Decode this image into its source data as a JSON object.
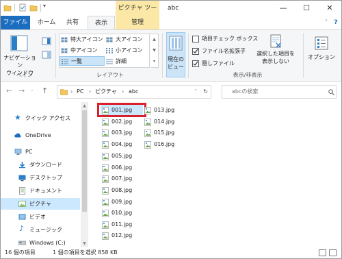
{
  "titlebar": {
    "context_tab": "ピクチャ ツール",
    "title": "abc",
    "minimize": "—",
    "maximize": "☐",
    "close": "✕"
  },
  "tabs": {
    "file": "ファイル",
    "home": "ホーム",
    "share": "共有",
    "view": "表示",
    "manage": "管理"
  },
  "ribbon": {
    "nav_pane_label": "ナビゲーション\nウィンドウ",
    "pane_group": "ペイン",
    "layout_group": "レイアウト",
    "layout_items": [
      "特大アイコン",
      "大アイコン",
      "中アイコン",
      "小アイコン",
      "一覧",
      "詳細"
    ],
    "current_view_label": "現在の\nビュー",
    "checkbox_item": "項目チェック ボックス",
    "checkbox_ext": "ファイル名拡張子",
    "checkbox_hidden": "隠しファイル",
    "hide_selected": "選択した項目を\n表示しない",
    "show_hide_group": "表示/非表示",
    "options": "オプション"
  },
  "address": {
    "path": [
      "PC",
      "ピクチャ",
      "abc"
    ],
    "search_placeholder": "abcの検索"
  },
  "nav": {
    "items": [
      {
        "label": "クイック アクセス",
        "icon": "star-icon"
      },
      {
        "label": "OneDrive",
        "icon": "cloud-icon"
      },
      {
        "label": "PC",
        "icon": "pc-icon"
      },
      {
        "label": "ダウンロード",
        "icon": "download-icon"
      },
      {
        "label": "デスクトップ",
        "icon": "desktop-icon"
      },
      {
        "label": "ドキュメント",
        "icon": "documents-icon"
      },
      {
        "label": "ピクチャ",
        "icon": "pictures-icon"
      },
      {
        "label": "ビデオ",
        "icon": "video-icon"
      },
      {
        "label": "ミュージック",
        "icon": "music-icon"
      },
      {
        "label": "Windows (C:)",
        "icon": "drive-icon"
      }
    ]
  },
  "files": {
    "col1": [
      "001.jpg",
      "002.jpg",
      "003.jpg",
      "004.jpg",
      "005.jpg",
      "006.jpg",
      "007.jpg",
      "008.jpg",
      "009.jpg",
      "010.jpg",
      "011.jpg",
      "012.jpg"
    ],
    "col2": [
      "013.jpg",
      "014.jpg",
      "015.jpg",
      "016.jpg"
    ]
  },
  "status": {
    "count": "16 個の項目",
    "selection": "1 個の項目を選択  858 KB"
  },
  "colors": {
    "accent": "#1a6dbf",
    "context": "#fbe8a6",
    "selection": "#cce8ff",
    "highlight": "#d8202a"
  }
}
